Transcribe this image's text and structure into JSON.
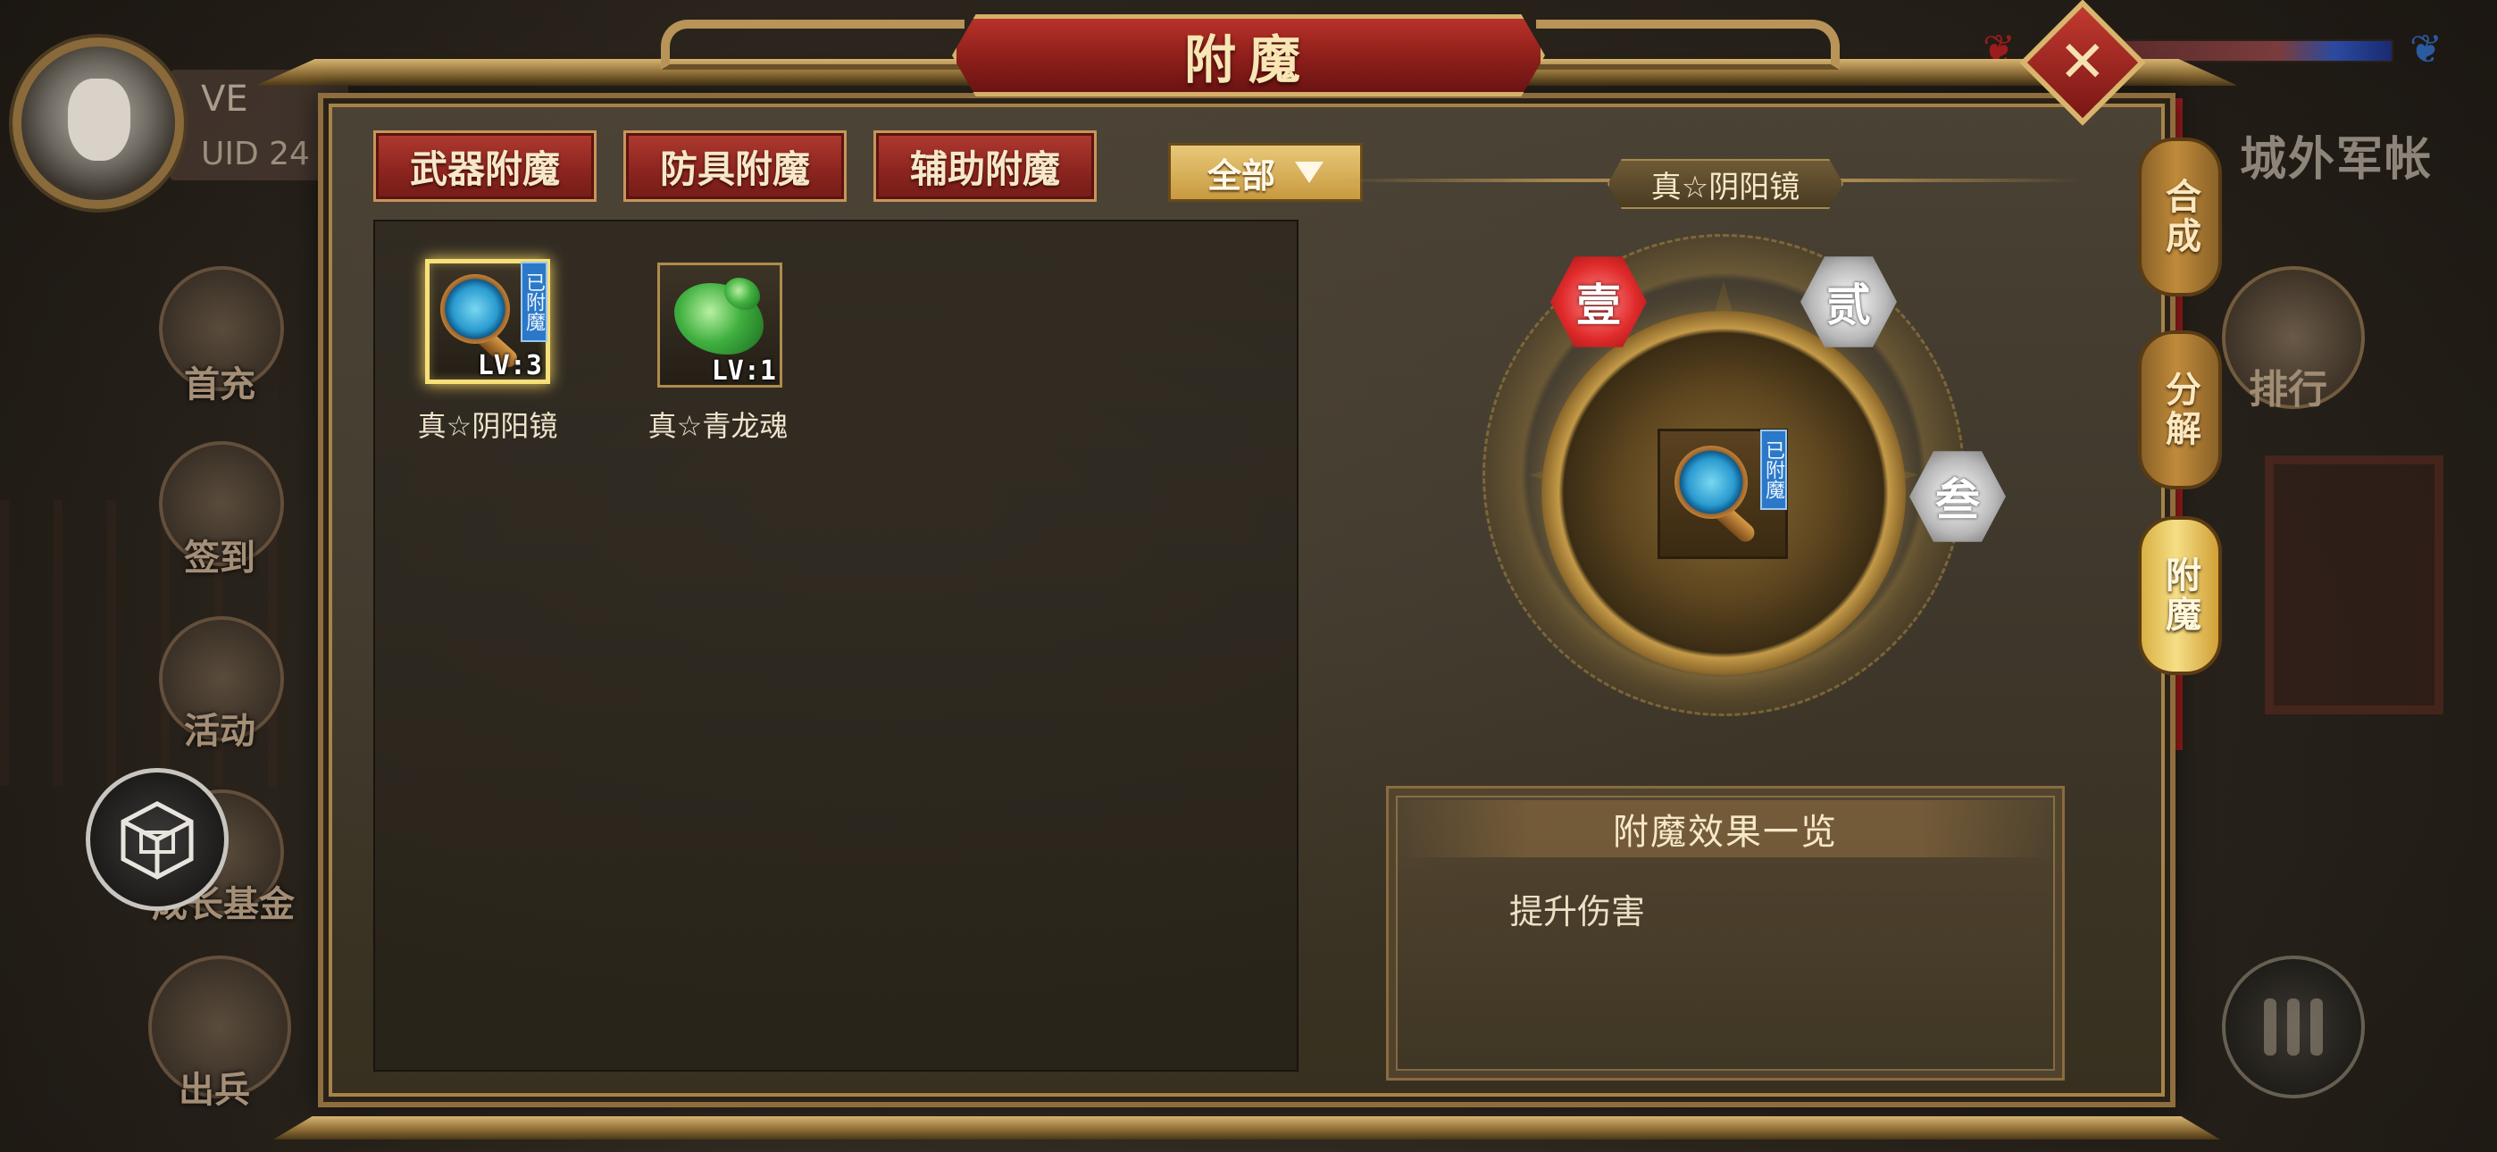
{
  "dialog": {
    "title": "附魔",
    "close_label": "✕"
  },
  "player": {
    "name": "VE",
    "uid": "UID  24"
  },
  "side_menu": [
    {
      "label": "首充"
    },
    {
      "label": "签到"
    },
    {
      "label": "活动"
    },
    {
      "label": "成长基金"
    },
    {
      "label": "出兵"
    }
  ],
  "right_hud": {
    "location": "城外军帐",
    "rank_label": "排行"
  },
  "tabs": [
    {
      "label": "武器附魔"
    },
    {
      "label": "防具附魔"
    },
    {
      "label": "辅助附魔"
    }
  ],
  "filter": {
    "selected": "全部"
  },
  "inventory": [
    {
      "name": "真☆阴阳镜",
      "level": "LV:3",
      "tag": "已附魔",
      "selected": true,
      "icon": "mirror-icon"
    },
    {
      "name": "真☆青龙魂",
      "level": "LV:1",
      "tag": "",
      "selected": false,
      "icon": "dragon-icon"
    }
  ],
  "detail": {
    "item_name": "真☆阴阳镜",
    "center_tag": "已附魔",
    "slots": [
      {
        "label": "壹",
        "state": "red"
      },
      {
        "label": "贰",
        "state": "silver"
      },
      {
        "label": "叁",
        "state": "silver"
      }
    ]
  },
  "effects": {
    "header": "附魔效果一览",
    "lines": [
      "提升伤害"
    ]
  },
  "vertical_tabs": [
    {
      "label": "合成",
      "active": false
    },
    {
      "label": "分解",
      "active": false
    },
    {
      "label": "附魔",
      "active": true
    }
  ],
  "colors": {
    "tab_red": "#8a241e",
    "dropdown_gold": "#c89a40",
    "active_vtab_gold": "#f6de86",
    "enchant_tag_blue": "#2c78c8",
    "slot_red": "#e02a2a",
    "slot_silver": "#b8b8b8"
  }
}
